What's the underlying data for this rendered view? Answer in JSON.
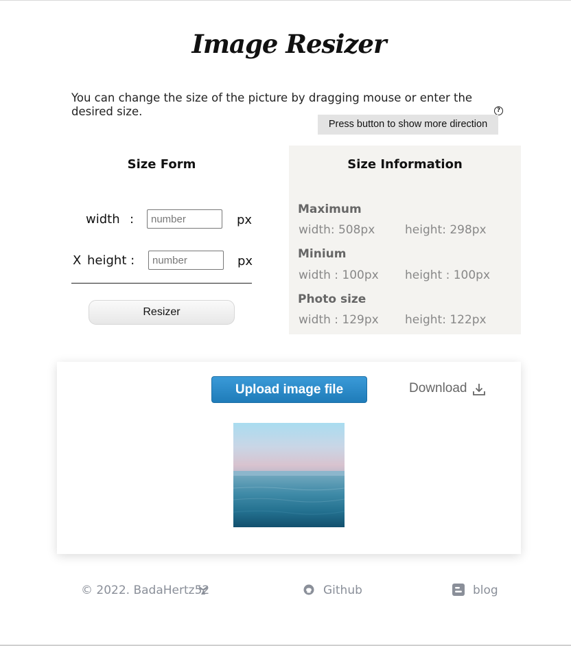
{
  "header": {
    "title": "Image Resizer"
  },
  "intro": {
    "text": "You can change the size of the picture by dragging mouse or enter the desired size.",
    "hint_button": "Press button to show more direction"
  },
  "form": {
    "title": "Size Form",
    "width_label": "width",
    "width_colon": ":",
    "height_prefix": "X",
    "height_label": "height :",
    "placeholder": "number",
    "unit": "px",
    "resize_button": "Resizer"
  },
  "info": {
    "title": "Size Information",
    "maximum": {
      "heading": "Maximum",
      "width": "width:  508px",
      "height": "height:  298px"
    },
    "minimum": {
      "heading": "Minium",
      "width": "width :  100px",
      "height": "height :  100px"
    },
    "photo": {
      "heading": "Photo size",
      "width": "width :  129px",
      "height": "height:  122px"
    }
  },
  "card": {
    "upload_button": "Upload image file",
    "download_label": "Download"
  },
  "footer": {
    "copyright": "© 2022. BadaHertz52",
    "github": "Github",
    "blog": "blog"
  },
  "colors": {
    "upload_blue": "#2585c6",
    "panel_bg": "#f4f3f0",
    "muted_text": "#888888",
    "footer_text": "#8a8f99"
  }
}
